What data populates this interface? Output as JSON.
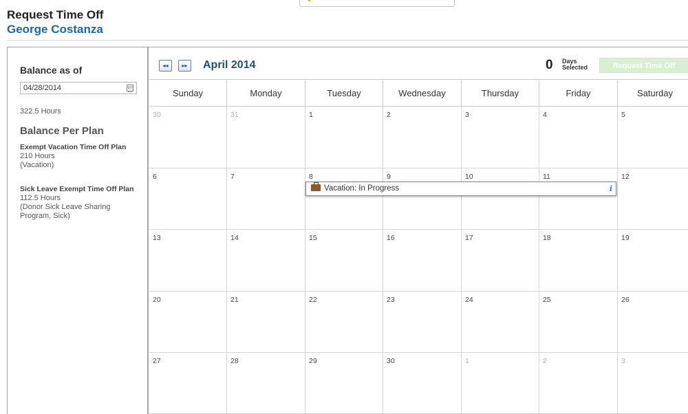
{
  "header": {
    "title": "Request Time Off",
    "employee_name": "George Costanza"
  },
  "sidebar": {
    "balance_heading": "Balance as of",
    "balance_date": "04/28/2014",
    "total_hours": "322.5 Hours",
    "per_plan_heading": "Balance Per Plan",
    "plans": [
      {
        "name": "Exempt Vacation Time Off Plan",
        "hours": "210 Hours",
        "types": "(Vacation)"
      },
      {
        "name": "Sick Leave Exempt Time Off Plan",
        "hours": "112.5 Hours",
        "types_line1": "(Donor Sick Leave Sharing",
        "types_line2": "Program, Sick)"
      }
    ]
  },
  "calendar": {
    "prev_icon": "rewind-icon",
    "next_icon": "fast-forward-icon",
    "prev_glyph": "◂◂",
    "next_glyph": "▸▸",
    "month": "April 2014",
    "days_selected_count": "0",
    "days_label_line1": "Days",
    "days_label_line2": "Selected",
    "request_button": "Request Time Off",
    "weekdays": [
      "Sunday",
      "Monday",
      "Tuesday",
      "Wednesday",
      "Thursday",
      "Friday",
      "Saturday"
    ],
    "weeks": [
      [
        "30",
        "31",
        "1",
        "2",
        "3",
        "4",
        "5"
      ],
      [
        "6",
        "7",
        "8",
        "9",
        "10",
        "11",
        "12"
      ],
      [
        "13",
        "14",
        "15",
        "16",
        "17",
        "18",
        "19"
      ],
      [
        "20",
        "21",
        "22",
        "23",
        "24",
        "25",
        "26"
      ],
      [
        "27",
        "28",
        "29",
        "30",
        "1",
        "2",
        "3"
      ]
    ],
    "event": {
      "label": "Vacation: In Progress",
      "icon": "briefcase-icon",
      "info_glyph": "i"
    }
  },
  "colors": {
    "brand_blue": "#1a69a8",
    "month_blue": "#1f4f80",
    "request_button_disabled": "#d9efd2",
    "briefcase": "#8b5a2b"
  }
}
